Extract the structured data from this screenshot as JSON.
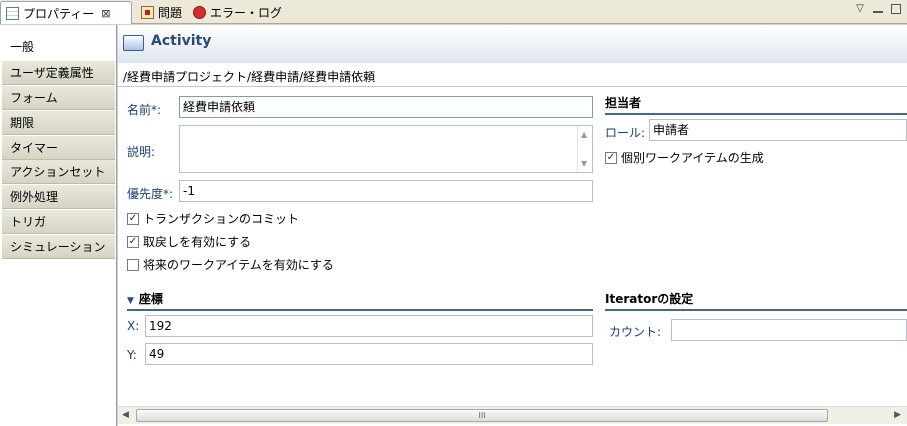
{
  "tabs": {
    "properties": "プロパティー",
    "close_glyph": "⊠",
    "problems": "問題",
    "error_log": "エラー・ログ"
  },
  "view_controls": {
    "menu": "▽"
  },
  "sidebar": {
    "items": [
      {
        "label": "一般",
        "active": true
      },
      {
        "label": "ユーザ定義属性"
      },
      {
        "label": "フォーム"
      },
      {
        "label": "期限"
      },
      {
        "label": "タイマー"
      },
      {
        "label": "アクションセット"
      },
      {
        "label": "例外処理"
      },
      {
        "label": "トリガ"
      },
      {
        "label": "シミュレーション"
      }
    ]
  },
  "header": {
    "title": "Activity"
  },
  "path": "/経費申請プロジェクト/経費申請/経費申請依頼",
  "form": {
    "name_label": "名前*:",
    "name_value": "経費申請依頼",
    "desc_label": "説明:",
    "desc_value": "",
    "priority_label": "優先度*:",
    "priority_value": "-1",
    "checks": [
      {
        "label": "トランザクションのコミット",
        "checked": true
      },
      {
        "label": "取戻しを有効にする",
        "checked": true
      },
      {
        "label": "将来のワークアイテムを有効にする",
        "checked": false
      }
    ]
  },
  "assignee": {
    "title": "担当者",
    "role_label": "ロール:",
    "role_value": "申請者",
    "individual_label": "個別ワークアイテムの生成",
    "individual_checked": true
  },
  "coords": {
    "title": "座標",
    "x_label": "X:",
    "x_value": "192",
    "y_label": "Y:",
    "y_value": "49"
  },
  "iterator": {
    "title": "Iteratorの設定",
    "count_label": "カウント:",
    "count_value": ""
  },
  "scrollbar": {
    "grip": "III"
  },
  "colors": {
    "accent": "#3f6a8e",
    "label": "#1a3d78",
    "header_title": "#2c4a77"
  }
}
